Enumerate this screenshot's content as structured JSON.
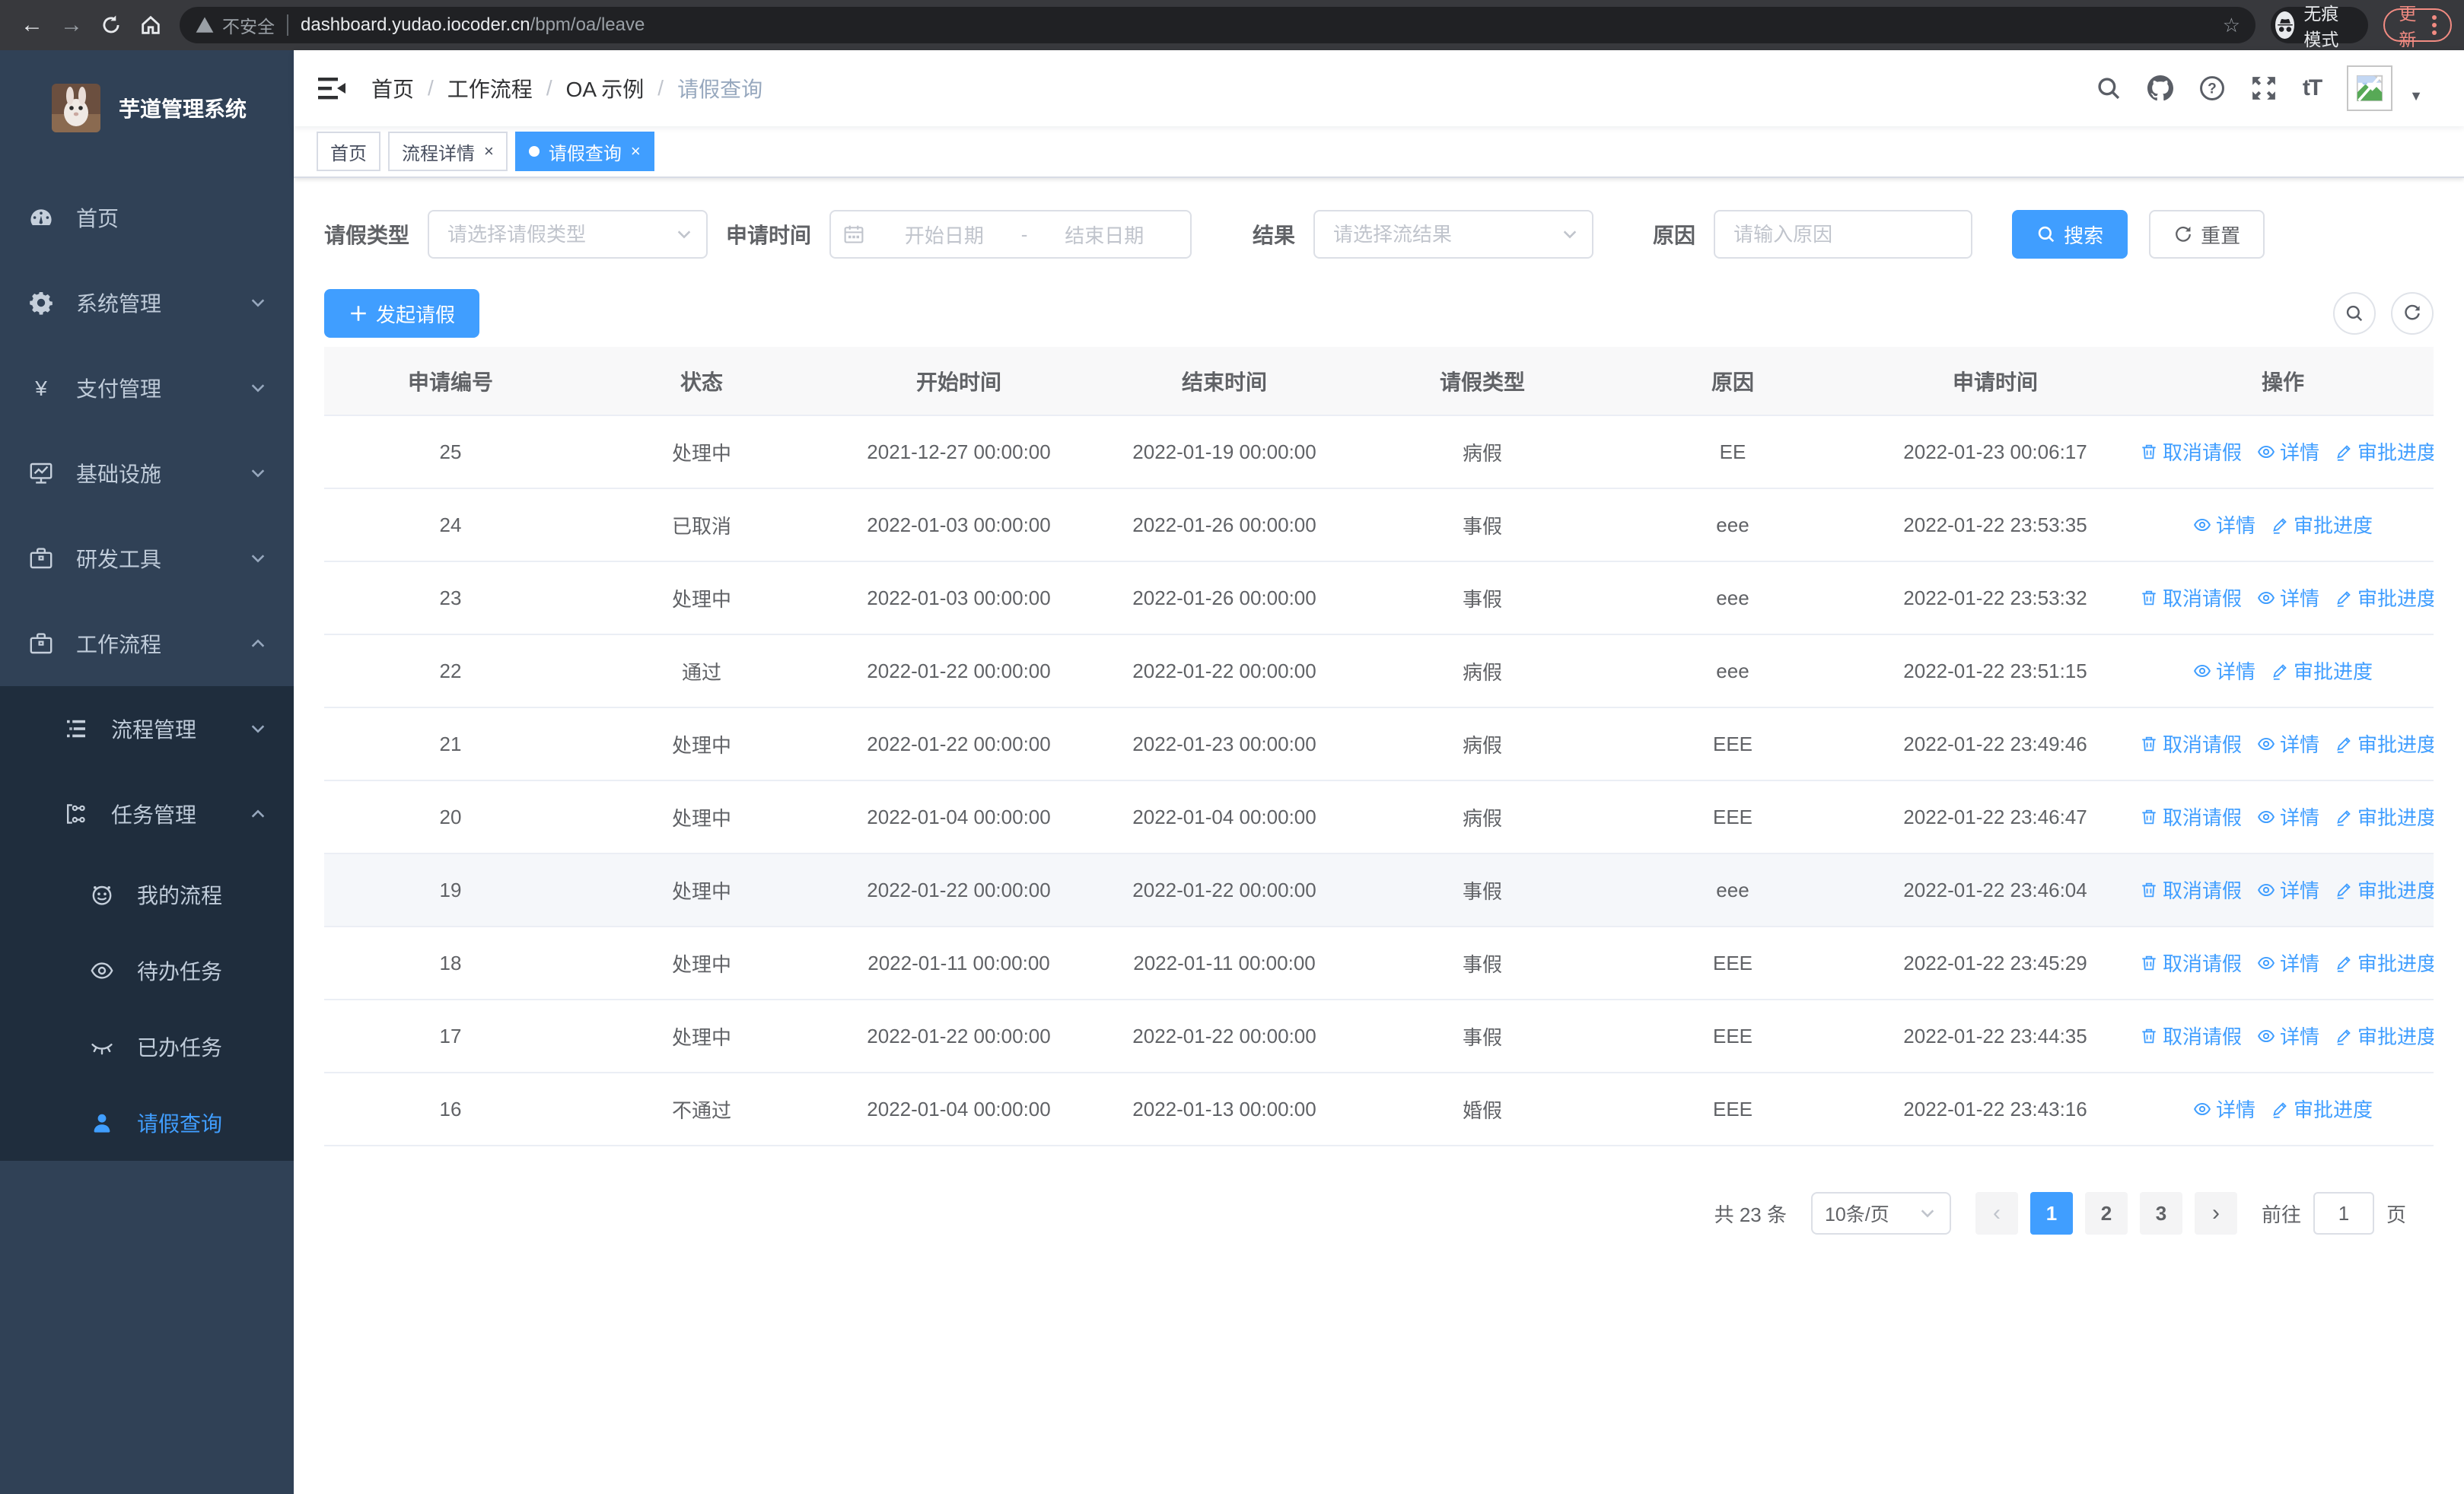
{
  "colors": {
    "primary": "#409eff",
    "sidebar_bg": "#304156",
    "submenu_bg": "#1f2d3d",
    "sidebar_text": "#bfcbd9",
    "chrome_bg": "#38393d",
    "omnibox_bg": "#202124",
    "update_accent": "#f28b82",
    "table_header_bg": "#f8f8f9",
    "row_highlight": "#f5f7fa"
  },
  "browser": {
    "security_label": "不安全",
    "url_host": "dashboard.yudao.iocoder.cn",
    "url_path": "/bpm/oa/leave",
    "incognito_label": "无痕模式",
    "update_label": "更新"
  },
  "sidebar": {
    "title": "芋道管理系统",
    "menu": [
      {
        "name": "sidebar-item-home",
        "label": "首页",
        "icon": "dashboard-icon",
        "level": 1,
        "chevron": "",
        "submenu": false,
        "active": false
      },
      {
        "name": "sidebar-item-system",
        "label": "系统管理",
        "icon": "gear-icon",
        "level": 1,
        "chevron": "down",
        "submenu": false,
        "active": false
      },
      {
        "name": "sidebar-item-payment",
        "label": "支付管理",
        "icon": "yen-icon",
        "level": 1,
        "chevron": "down",
        "submenu": false,
        "active": false
      },
      {
        "name": "sidebar-item-infra",
        "label": "基础设施",
        "icon": "monitor-icon",
        "level": 1,
        "chevron": "down",
        "submenu": false,
        "active": false
      },
      {
        "name": "sidebar-item-devtools",
        "label": "研发工具",
        "icon": "briefcase-icon",
        "level": 1,
        "chevron": "down",
        "submenu": false,
        "active": false
      },
      {
        "name": "sidebar-item-workflow",
        "label": "工作流程",
        "icon": "briefcase-icon",
        "level": 1,
        "chevron": "up",
        "submenu": false,
        "active": false
      },
      {
        "name": "sidebar-item-process-mgmt",
        "label": "流程管理",
        "icon": "list-tree-icon",
        "level": 2,
        "chevron": "down",
        "submenu": true,
        "active": false
      },
      {
        "name": "sidebar-item-task-mgmt",
        "label": "任务管理",
        "icon": "flow-icon",
        "level": 2,
        "chevron": "up",
        "submenu": true,
        "active": false
      },
      {
        "name": "sidebar-item-my-process",
        "label": "我的流程",
        "icon": "robot-icon",
        "level": 3,
        "chevron": "",
        "submenu": true,
        "active": false
      },
      {
        "name": "sidebar-item-todo-task",
        "label": "待办任务",
        "icon": "eye-open-icon",
        "level": 3,
        "chevron": "",
        "submenu": true,
        "active": false
      },
      {
        "name": "sidebar-item-done-task",
        "label": "已办任务",
        "icon": "eye-closed-icon",
        "level": 3,
        "chevron": "",
        "submenu": true,
        "active": false
      },
      {
        "name": "sidebar-item-leave-query",
        "label": "请假查询",
        "icon": "user-icon",
        "level": 3,
        "chevron": "",
        "submenu": true,
        "active": true
      }
    ]
  },
  "header": {
    "breadcrumb": [
      "首页",
      "工作流程",
      "OA 示例",
      "请假查询"
    ],
    "tabs": [
      {
        "name": "tab-home",
        "label": "首页",
        "active": false,
        "closable": false
      },
      {
        "name": "tab-process-detail",
        "label": "流程详情",
        "active": false,
        "closable": true
      },
      {
        "name": "tab-leave-query",
        "label": "请假查询",
        "active": true,
        "closable": true
      }
    ]
  },
  "filters": {
    "leave_type_label": "请假类型",
    "leave_type_placeholder": "请选择请假类型",
    "apply_time_label": "申请时间",
    "start_placeholder": "开始日期",
    "separator": "-",
    "end_placeholder": "结束日期",
    "result_label": "结果",
    "result_placeholder": "请选择流结果",
    "reason_label": "原因",
    "reason_placeholder": "请输入原因",
    "search_label": "搜索",
    "reset_label": "重置"
  },
  "toolbar": {
    "create_label": "发起请假"
  },
  "table": {
    "columns": [
      "申请编号",
      "状态",
      "开始时间",
      "结束时间",
      "请假类型",
      "原因",
      "申请时间",
      "操作"
    ],
    "action_labels": {
      "cancel": "取消请假",
      "detail": "详情",
      "progress": "审批进度"
    },
    "rows": [
      {
        "id": "25",
        "status": "处理中",
        "start": "2021-12-27 00:00:00",
        "end": "2022-01-19 00:00:00",
        "type": "病假",
        "reason": "EE",
        "apply_time": "2022-01-23 00:06:17",
        "actions": [
          "cancel",
          "detail",
          "progress"
        ],
        "highlight": false
      },
      {
        "id": "24",
        "status": "已取消",
        "start": "2022-01-03 00:00:00",
        "end": "2022-01-26 00:00:00",
        "type": "事假",
        "reason": "eee",
        "apply_time": "2022-01-22 23:53:35",
        "actions": [
          "detail",
          "progress"
        ],
        "highlight": false
      },
      {
        "id": "23",
        "status": "处理中",
        "start": "2022-01-03 00:00:00",
        "end": "2022-01-26 00:00:00",
        "type": "事假",
        "reason": "eee",
        "apply_time": "2022-01-22 23:53:32",
        "actions": [
          "cancel",
          "detail",
          "progress"
        ],
        "highlight": false
      },
      {
        "id": "22",
        "status": "通过",
        "start": "2022-01-22 00:00:00",
        "end": "2022-01-22 00:00:00",
        "type": "病假",
        "reason": "eee",
        "apply_time": "2022-01-22 23:51:15",
        "actions": [
          "detail",
          "progress"
        ],
        "highlight": false
      },
      {
        "id": "21",
        "status": "处理中",
        "start": "2022-01-22 00:00:00",
        "end": "2022-01-23 00:00:00",
        "type": "病假",
        "reason": "EEE",
        "apply_time": "2022-01-22 23:49:46",
        "actions": [
          "cancel",
          "detail",
          "progress"
        ],
        "highlight": false
      },
      {
        "id": "20",
        "status": "处理中",
        "start": "2022-01-04 00:00:00",
        "end": "2022-01-04 00:00:00",
        "type": "病假",
        "reason": "EEE",
        "apply_time": "2022-01-22 23:46:47",
        "actions": [
          "cancel",
          "detail",
          "progress"
        ],
        "highlight": false
      },
      {
        "id": "19",
        "status": "处理中",
        "start": "2022-01-22 00:00:00",
        "end": "2022-01-22 00:00:00",
        "type": "事假",
        "reason": "eee",
        "apply_time": "2022-01-22 23:46:04",
        "actions": [
          "cancel",
          "detail",
          "progress"
        ],
        "highlight": true
      },
      {
        "id": "18",
        "status": "处理中",
        "start": "2022-01-11 00:00:00",
        "end": "2022-01-11 00:00:00",
        "type": "事假",
        "reason": "EEE",
        "apply_time": "2022-01-22 23:45:29",
        "actions": [
          "cancel",
          "detail",
          "progress"
        ],
        "highlight": false
      },
      {
        "id": "17",
        "status": "处理中",
        "start": "2022-01-22 00:00:00",
        "end": "2022-01-22 00:00:00",
        "type": "事假",
        "reason": "EEE",
        "apply_time": "2022-01-22 23:44:35",
        "actions": [
          "cancel",
          "detail",
          "progress"
        ],
        "highlight": false
      },
      {
        "id": "16",
        "status": "不通过",
        "start": "2022-01-04 00:00:00",
        "end": "2022-01-13 00:00:00",
        "type": "婚假",
        "reason": "EEE",
        "apply_time": "2022-01-22 23:43:16",
        "actions": [
          "detail",
          "progress"
        ],
        "highlight": false
      }
    ]
  },
  "pagination": {
    "total_label": "共 23 条",
    "page_size": "10条/页",
    "pages": [
      "1",
      "2",
      "3"
    ],
    "active_page": "1",
    "prev_enabled": false,
    "next_enabled": true,
    "goto_label": "前往",
    "goto_value": "1",
    "page_unit": "页"
  }
}
